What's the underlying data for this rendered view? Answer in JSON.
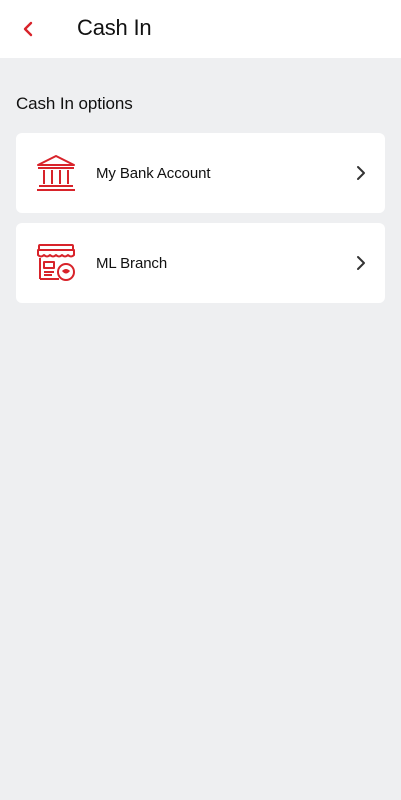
{
  "header": {
    "title": "Cash In",
    "back_icon": "chevron-left-icon"
  },
  "colors": {
    "accent": "#d8232a",
    "background": "#eeeff1",
    "card": "#ffffff",
    "text": "#111111"
  },
  "section": {
    "title": "Cash In options"
  },
  "options": [
    {
      "label": "My Bank Account",
      "icon": "bank-icon"
    },
    {
      "label": "ML Branch",
      "icon": "store-icon"
    }
  ]
}
